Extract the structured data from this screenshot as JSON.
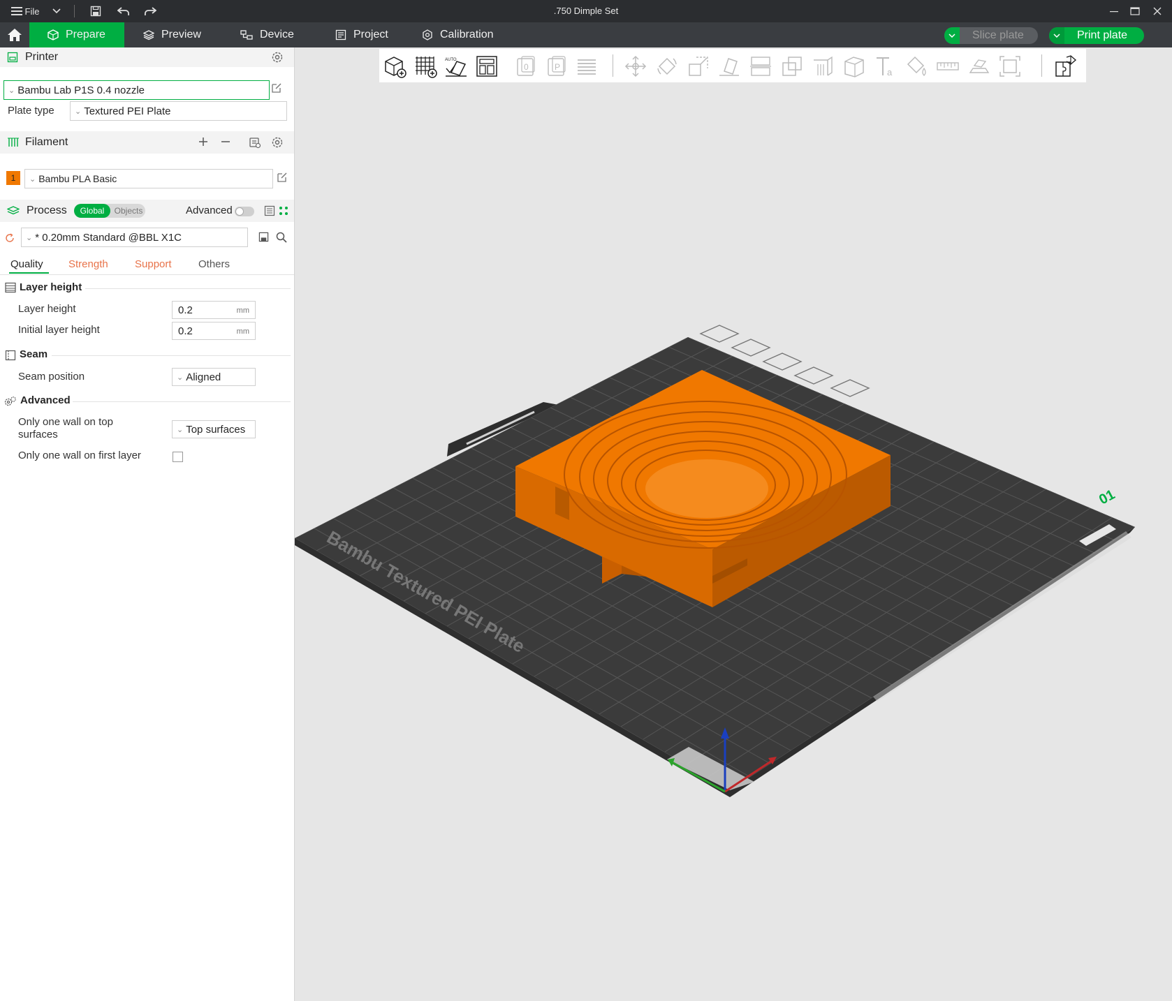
{
  "window": {
    "title": ".750 Dimple Set",
    "menu_label": "File"
  },
  "nav": {
    "tabs": [
      {
        "label": "Prepare"
      },
      {
        "label": "Preview"
      },
      {
        "label": "Device"
      },
      {
        "label": "Project"
      },
      {
        "label": "Calibration"
      }
    ],
    "slice_label": "Slice plate",
    "print_label": "Print plate"
  },
  "printer": {
    "header": "Printer",
    "name": "Bambu Lab P1S 0.4 nozzle",
    "plate_type_label": "Plate type",
    "plate_type": "Textured PEI Plate"
  },
  "filament": {
    "header": "Filament",
    "slot_number": "1",
    "slot_color": "#f07800",
    "name": "Bambu PLA Basic"
  },
  "process": {
    "header": "Process",
    "global_label": "Global",
    "objects_label": "Objects",
    "advanced_label": "Advanced",
    "preset": "* 0.20mm Standard @BBL X1C",
    "tabs": [
      "Quality",
      "Strength",
      "Support",
      "Others"
    ]
  },
  "quality": {
    "layer_height_group": "Layer height",
    "layer_height_label": "Layer height",
    "layer_height_value": "0.2",
    "initial_layer_height_label": "Initial layer height",
    "initial_layer_height_value": "0.2",
    "unit": "mm",
    "seam_group": "Seam",
    "seam_position_label": "Seam position",
    "seam_position_value": "Aligned",
    "advanced_group": "Advanced",
    "one_wall_top_label_1": "Only one wall on top",
    "one_wall_top_label_2": "surfaces",
    "one_wall_top_value": "Top surfaces",
    "one_wall_first_label": "Only one wall on first layer",
    "one_wall_first_checked": false
  },
  "viewport": {
    "plate_text": "Bambu Textured PEI Plate",
    "plate_number": "01",
    "model_color": "#f07800",
    "bed_color": "#3b3b3b"
  },
  "colors": {
    "accent": "#00ae42",
    "tab_orange": "#e8734a",
    "titlebar": "#2b2d30",
    "navbar": "#3a3d41"
  },
  "icons": {
    "add_object": "add-cube-icon",
    "grid": "grid-icon",
    "auto_orient": "auto-orient-icon",
    "arrange": "arrange-icon"
  }
}
